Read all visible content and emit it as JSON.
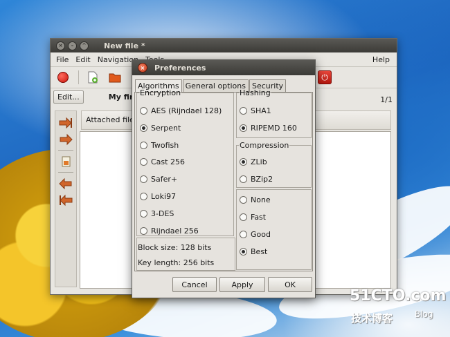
{
  "main_window": {
    "title": "New file *",
    "menu": [
      "File",
      "Edit",
      "Navigation",
      "Tools"
    ],
    "help": "Help",
    "edit_button": "Edit...",
    "file_label": "My first",
    "page_indicator": "1/1",
    "attached_header": "Attached files"
  },
  "dialog": {
    "title": "Preferences",
    "tabs": [
      "Algorithms",
      "General options",
      "Security"
    ],
    "encryption": {
      "legend": "Encryption",
      "options": [
        "AES (Rijndael 128)",
        "Serpent",
        "Twofish",
        "Cast 256",
        "Safer+",
        "Loki97",
        "3-DES",
        "Rijndael 256"
      ],
      "selected": "Serpent"
    },
    "hashing": {
      "legend": "Hashing",
      "options": [
        "SHA1",
        "RIPEMD 160"
      ],
      "selected": "RIPEMD 160"
    },
    "compression": {
      "legend": "Compression",
      "options": [
        "ZLib",
        "BZip2"
      ],
      "selected": "ZLib"
    },
    "level": {
      "options": [
        "None",
        "Fast",
        "Good",
        "Best"
      ],
      "selected": "Best"
    },
    "block_size": "Block size: 128 bits",
    "key_length": "Key length: 256 bits",
    "buttons": {
      "cancel": "Cancel",
      "apply": "Apply",
      "ok": "OK"
    }
  },
  "watermark": {
    "line1": "51CTO.com",
    "line2": "技术博客",
    "line3": "Blog"
  }
}
